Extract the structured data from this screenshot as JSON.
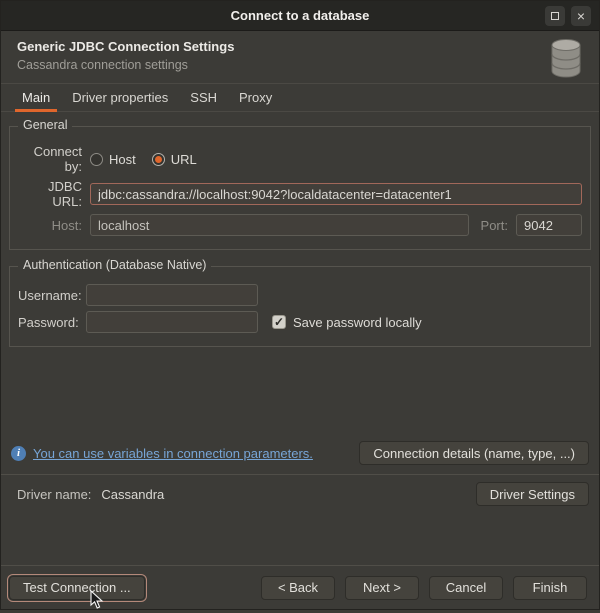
{
  "titlebar": {
    "title": "Connect to a database",
    "restore_icon": "restore-window-icon",
    "close_icon": "close-window-icon",
    "close_glyph": "×"
  },
  "header": {
    "title": "Generic JDBC Connection Settings",
    "subtitle": "Cassandra connection settings",
    "icon": "database-icon"
  },
  "tabs": [
    {
      "label": "Main",
      "selected": true
    },
    {
      "label": "Driver properties",
      "selected": false
    },
    {
      "label": "SSH",
      "selected": false
    },
    {
      "label": "Proxy",
      "selected": false
    }
  ],
  "general": {
    "group_label": "General",
    "connect_by_label": "Connect by:",
    "radio_host_label": "Host",
    "radio_url_label": "URL",
    "radio_selected": "URL",
    "jdbc_url_label": "JDBC URL:",
    "jdbc_url_value": "jdbc:cassandra://localhost:9042?localdatacenter=datacenter1",
    "host_label": "Host:",
    "host_value": "localhost",
    "port_label": "Port:",
    "port_value": "9042"
  },
  "auth": {
    "group_label": "Authentication (Database Native)",
    "username_label": "Username:",
    "username_value": "",
    "password_label": "Password:",
    "password_value": "",
    "save_password_label": "Save password locally",
    "save_password_checked": true,
    "check_glyph": "✓"
  },
  "footer": {
    "info_icon": "info-icon",
    "info_glyph": "i",
    "variables_link": "You can use variables in connection parameters.",
    "connection_details_button": "Connection details (name, type, ...)",
    "driver_name_label": "Driver name:",
    "driver_name_value": "Cassandra",
    "driver_settings_button": "Driver Settings"
  },
  "actions": {
    "test_connection": "Test Connection ...",
    "back": "< Back",
    "next": "Next >",
    "cancel": "Cancel",
    "finish": "Finish"
  },
  "colors": {
    "accent_orange": "#e0662c",
    "link_blue": "#77a5d6",
    "jdbc_focus_border": "#a2685a",
    "dialog_bg": "#3c3b37",
    "titlebar_bg": "#262623"
  }
}
